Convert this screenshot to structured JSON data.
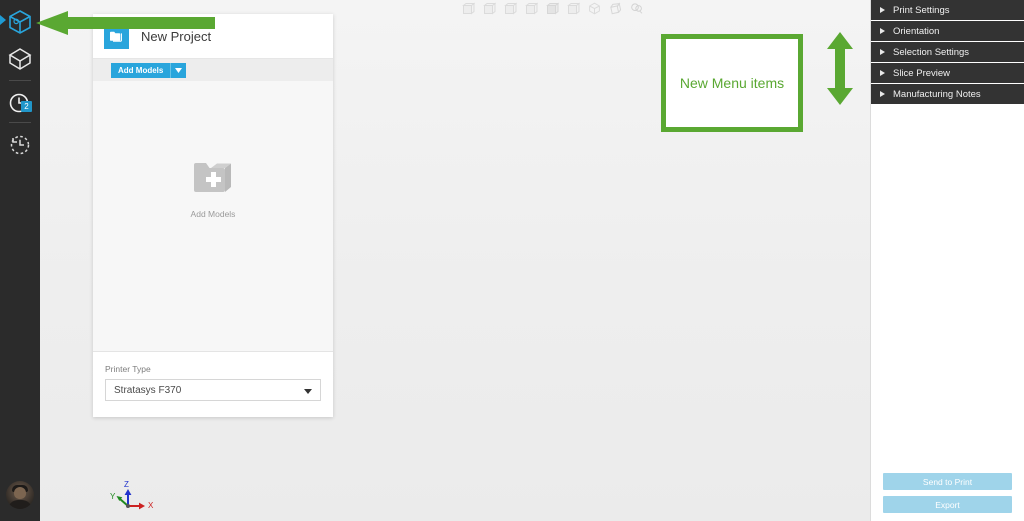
{
  "app": {
    "background_color": "#f1f1f1",
    "accent_blue": "#29a5dc",
    "annotation_green": "#5aa832",
    "panel_dark": "#333333"
  },
  "left_rail": {
    "items": [
      {
        "id": "model-view",
        "icon": "cube-3d-icon",
        "label": "Model View",
        "active": true,
        "badge": null
      },
      {
        "id": "pack-view",
        "icon": "cube-outline-icon",
        "label": "Pack View",
        "active": false,
        "badge": null
      },
      {
        "id": "queue",
        "icon": "clock-icon",
        "label": "Queue",
        "active": false,
        "badge": "2"
      },
      {
        "id": "history",
        "icon": "clock-history-icon",
        "label": "History",
        "active": false,
        "badge": null
      }
    ],
    "avatar": {
      "icon": "avatar",
      "label": "User Account"
    }
  },
  "view_toolbar": {
    "buttons": [
      {
        "id": "view-front",
        "icon": "cube-front-icon"
      },
      {
        "id": "view-back",
        "icon": "cube-back-icon"
      },
      {
        "id": "view-left",
        "icon": "cube-left-icon"
      },
      {
        "id": "view-right",
        "icon": "cube-right-icon"
      },
      {
        "id": "view-top",
        "icon": "cube-top-icon"
      },
      {
        "id": "view-bottom",
        "icon": "cube-bottom-icon"
      },
      {
        "id": "view-iso",
        "icon": "cube-iso-icon"
      },
      {
        "id": "view-rotate",
        "icon": "cube-rotate-icon"
      },
      {
        "id": "view-fit",
        "icon": "cube-fit-icon"
      }
    ]
  },
  "project_panel": {
    "folder_icon": "folder-icon",
    "title": "New Project",
    "add_models_button": {
      "label": "Add Models",
      "caret_icon": "chevron-down-icon"
    },
    "empty_state": {
      "icon": "folder-plus-icon",
      "label": "Add Models"
    },
    "printer": {
      "label": "Printer Type",
      "value": "Stratasys F370",
      "caret_icon": "chevron-down-icon",
      "options": [
        "Stratasys F370"
      ]
    }
  },
  "annotations": {
    "arrow_left": {
      "icon": "arrow-left-annotation",
      "color": "#5aa832"
    },
    "box": {
      "text": "New Menu items",
      "color": "#5aa832"
    },
    "arrow_updown": {
      "icon": "arrow-up-down-annotation",
      "color": "#5aa832"
    }
  },
  "right_panel": {
    "menu_items": [
      {
        "id": "print-settings",
        "label": "Print Settings",
        "caret_icon": "chevron-right-icon",
        "expanded": false
      },
      {
        "id": "orientation",
        "label": "Orientation",
        "caret_icon": "chevron-right-icon",
        "expanded": false
      },
      {
        "id": "selection-settings",
        "label": "Selection Settings",
        "caret_icon": "chevron-right-icon",
        "expanded": false
      },
      {
        "id": "slice-preview",
        "label": "Slice Preview",
        "caret_icon": "chevron-right-icon",
        "expanded": false
      },
      {
        "id": "manufacturing-notes",
        "label": "Manufacturing Notes",
        "caret_icon": "chevron-right-icon",
        "expanded": false
      }
    ],
    "actions": {
      "send_to_print": "Send to Print",
      "export": "Export"
    }
  },
  "axis_gizmo": {
    "x_label": "X",
    "y_label": "Y",
    "z_label": "Z",
    "x_color": "#cc2222",
    "y_color": "#1f8a1f",
    "z_color": "#2233cc"
  }
}
